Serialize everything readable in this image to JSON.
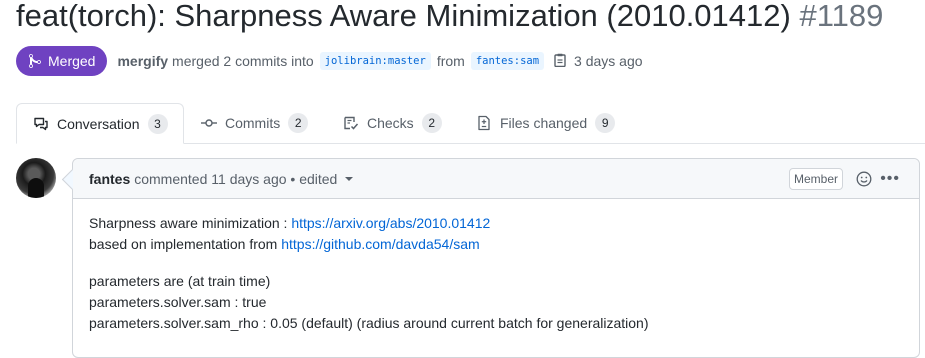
{
  "pr": {
    "title": "feat(torch): Sharpness Aware Minimization (2010.01412)",
    "number": "#1189",
    "state": "Merged",
    "author": "mergify",
    "action_text": "merged 2 commits into",
    "base_branch": "jolibrain:master",
    "from_text": "from",
    "head_branch": "fantes:sam",
    "time": "3 days ago"
  },
  "tabs": [
    {
      "label": "Conversation",
      "count": "3",
      "icon": "comment-discussion-icon"
    },
    {
      "label": "Commits",
      "count": "2",
      "icon": "git-commit-icon"
    },
    {
      "label": "Checks",
      "count": "2",
      "icon": "checklist-icon"
    },
    {
      "label": "Files changed",
      "count": "9",
      "icon": "file-diff-icon"
    }
  ],
  "comment": {
    "author": "fantes",
    "meta": "commented 11 days ago • edited",
    "role_badge": "Member",
    "lines": {
      "l1_text": "Sharpness aware minimization : ",
      "l1_link": "https://arxiv.org/abs/2010.01412",
      "l2_text": "based on implementation from ",
      "l2_link": "https://github.com/davda54/sam",
      "l3": "parameters are (at train time)",
      "l4": "parameters.solver.sam : true",
      "l5": "parameters.solver.sam_rho : 0.05 (default) (radius around current batch for generalization)"
    }
  },
  "colors": {
    "merged": "#6f42c1",
    "link": "#0366d6",
    "branch_bg": "#eaf5ff"
  }
}
